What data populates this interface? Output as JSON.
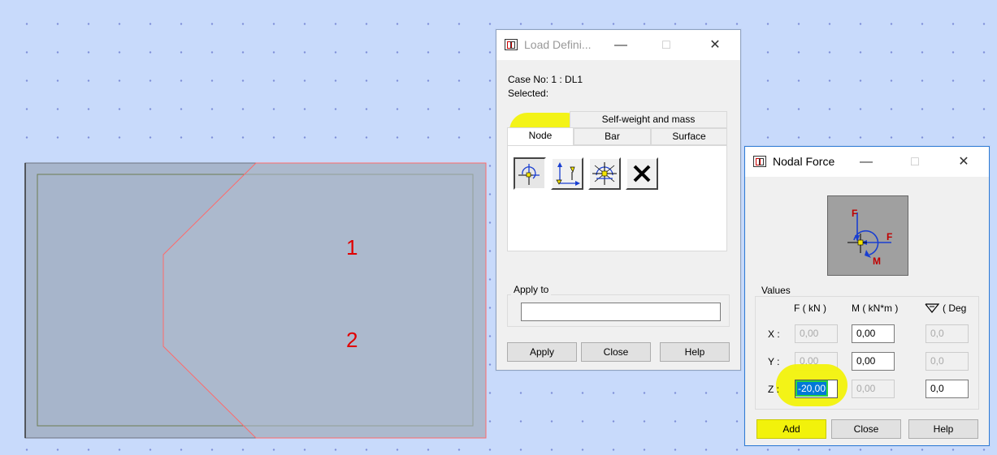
{
  "canvas": {
    "region_labels": [
      "1",
      "2"
    ],
    "colors": {
      "background": "#c8dafb",
      "slab_fill": "#a7b5cb",
      "slab_edge": "#ff6a6a",
      "region_label": "#e00000"
    }
  },
  "load_definition": {
    "title": "Load Defini...",
    "case_line": "Case No: 1 : DL1",
    "selected_label": "Selected:",
    "top_tab": "Self-weight and mass",
    "tabs": [
      "Node",
      "Bar",
      "Surface"
    ],
    "tools": [
      "nodal-force-icon",
      "imposed-displacement-icon",
      "body-force-icon",
      "delete-load-icon"
    ],
    "apply_to_label": "Apply to",
    "apply_to_value": "",
    "buttons": {
      "apply": "Apply",
      "close": "Close",
      "help": "Help"
    }
  },
  "nodal_force": {
    "title": "Nodal Force",
    "diagram_labels": {
      "f_top": "F",
      "f_right": "F",
      "m": "M"
    },
    "values_label": "Values",
    "col_headers": {
      "f": "F ( kN )",
      "m": "M ( kN*m )",
      "deg": "( Deg"
    },
    "rows": [
      {
        "label": "X :",
        "f": "0,00",
        "m": "0,00",
        "deg": "0,0"
      },
      {
        "label": "Y :",
        "f": "0,00",
        "m": "0,00",
        "deg": "0,0"
      },
      {
        "label": "Z :",
        "f": "-20,00",
        "m": "0,00",
        "deg": "0,0"
      }
    ],
    "buttons": {
      "add": "Add",
      "close": "Close",
      "help": "Help"
    }
  },
  "highlight_color": "#f2f20b"
}
